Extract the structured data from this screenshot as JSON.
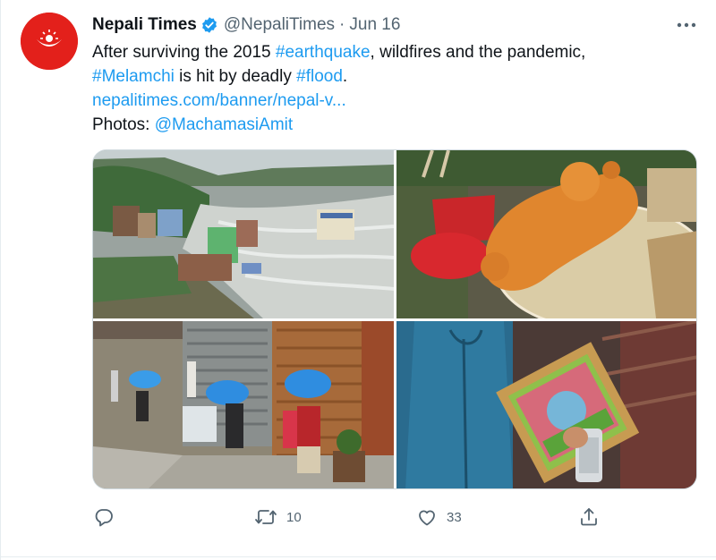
{
  "tweet": {
    "author_name": "Nepali Times",
    "handle": "@NepaliTimes",
    "separator": "·",
    "date": "Jun 16",
    "text_line1_a": "After surviving the 2015 ",
    "hashtag_earthquake": "#earthquake",
    "text_line1_b": ", wildfires and the pandemic,",
    "hashtag_melamchi": "#Melamchi",
    "text_line2_a": " is hit by deadly ",
    "hashtag_flood": "#flood",
    "text_line2_b": ".",
    "link_url": "nepalitimes.com/banner/nepal-v...",
    "photos_label": "Photos: ",
    "photos_mention": "@MachamasiAmit"
  },
  "media": {
    "photos": [
      {
        "icon": "flooded-town-photo"
      },
      {
        "icon": "teddy-bear-debris-photo"
      },
      {
        "icon": "people-carrying-sacks-photo"
      },
      {
        "icon": "framed-painting-photo"
      }
    ]
  },
  "actions": {
    "reply_count": "",
    "retweet_count": "10",
    "like_count": "33",
    "share_count": ""
  },
  "colors": {
    "accent": "#1d9bf0",
    "avatar_bg": "#e3201b",
    "icon_gray": "#536471"
  }
}
